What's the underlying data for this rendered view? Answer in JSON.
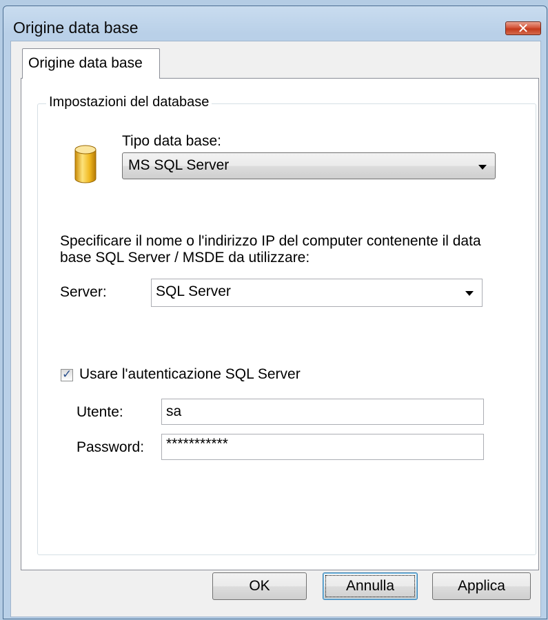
{
  "window": {
    "title": "Origine data base",
    "close_glyph": "✕"
  },
  "tab": {
    "label": "Origine data base"
  },
  "group": {
    "label": "Impostazioni del database",
    "db_type_label": "Tipo data base:",
    "db_type_value": "MS SQL Server",
    "instructions_line1": "Specificare il nome o l'indirizzo IP del computer contenente il data",
    "instructions_line2": "base SQL Server / MSDE da utilizzare:",
    "server_label": "Server:",
    "server_value": "SQL Server",
    "sql_auth_label": "Usare l'autenticazione SQL Server",
    "sql_auth_checked": true,
    "user_label": "Utente:",
    "user_value": "sa",
    "password_label": "Password:",
    "password_value": "***********",
    "icon": "database-icon"
  },
  "buttons": {
    "ok": "OK",
    "cancel": "Annulla",
    "apply": "Applica"
  },
  "colors": {
    "titlebar": "#b9d0e8",
    "close_button": "#c43a1d",
    "database_icon": "#e8b21c",
    "focus_border": "#3c7fb1"
  }
}
